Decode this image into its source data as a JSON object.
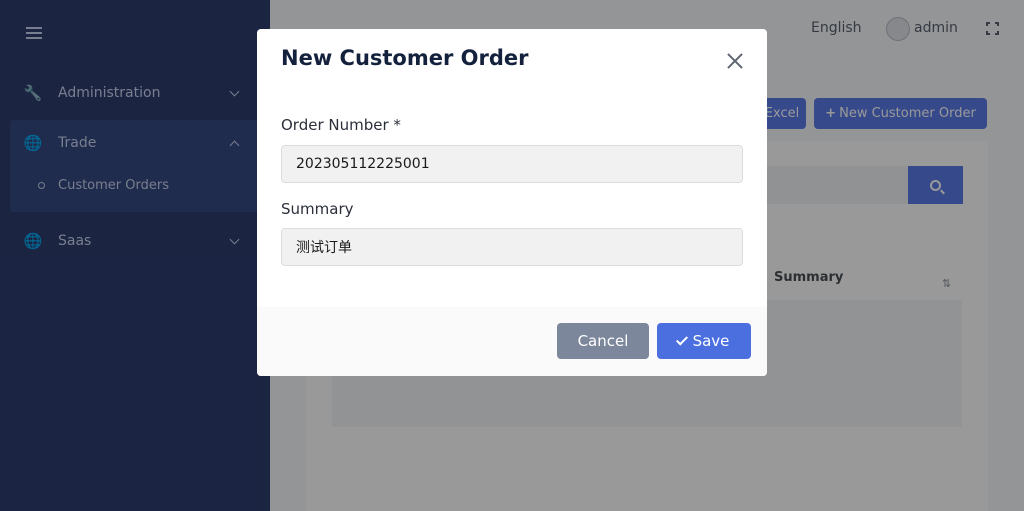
{
  "sidebar": {
    "items": [
      {
        "label": "Administration",
        "icon": "wrench-icon"
      },
      {
        "label": "Trade",
        "icon": "globe-icon",
        "expanded": true,
        "children": [
          {
            "label": "Customer Orders"
          }
        ]
      },
      {
        "label": "Saas",
        "icon": "globe-icon"
      }
    ]
  },
  "topbar": {
    "language": "English",
    "user": "admin"
  },
  "toolbar": {
    "excel_label": "Excel",
    "new_order_label": "New Customer Order"
  },
  "table": {
    "columns": [
      "Summary"
    ]
  },
  "modal": {
    "title": "New Customer Order",
    "fields": {
      "order_number": {
        "label": "Order Number *",
        "value": "202305112225001"
      },
      "summary": {
        "label": "Summary",
        "value": "测试订单"
      }
    },
    "buttons": {
      "cancel": "Cancel",
      "save": "Save"
    }
  },
  "colors": {
    "sidebar": "#2d3e6f",
    "primary": "#4c6fe0",
    "cancel": "#7d879c",
    "title": "#14213d"
  }
}
